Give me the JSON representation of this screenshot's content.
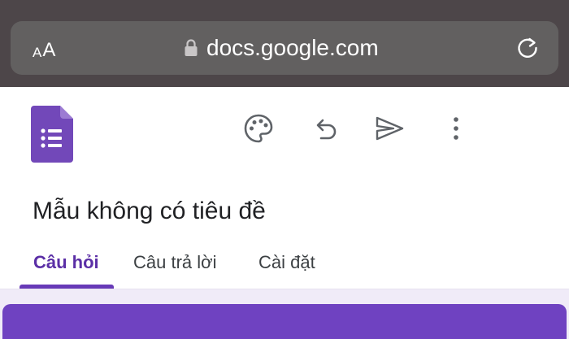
{
  "browser": {
    "text_size_small": "A",
    "text_size_large": "A",
    "address": "docs.google.com",
    "icons": {
      "lock": "lock-icon",
      "reload": "reload-icon"
    },
    "colors": {
      "toolbar": "#4d4649",
      "url_field": "#626060"
    }
  },
  "forms": {
    "title": "Mẫu không có tiêu đề",
    "toolbar_icons": [
      "palette-icon",
      "undo-icon",
      "send-icon",
      "more-vert-icon"
    ],
    "tabs": [
      {
        "label": "Câu hỏi",
        "active": true
      },
      {
        "label": "Câu trả lời",
        "active": false
      },
      {
        "label": "Cài đặt",
        "active": false
      }
    ],
    "colors": {
      "brand": "#673ab7",
      "card_header": "#6f42c1",
      "background": "#f0ebf8"
    }
  }
}
